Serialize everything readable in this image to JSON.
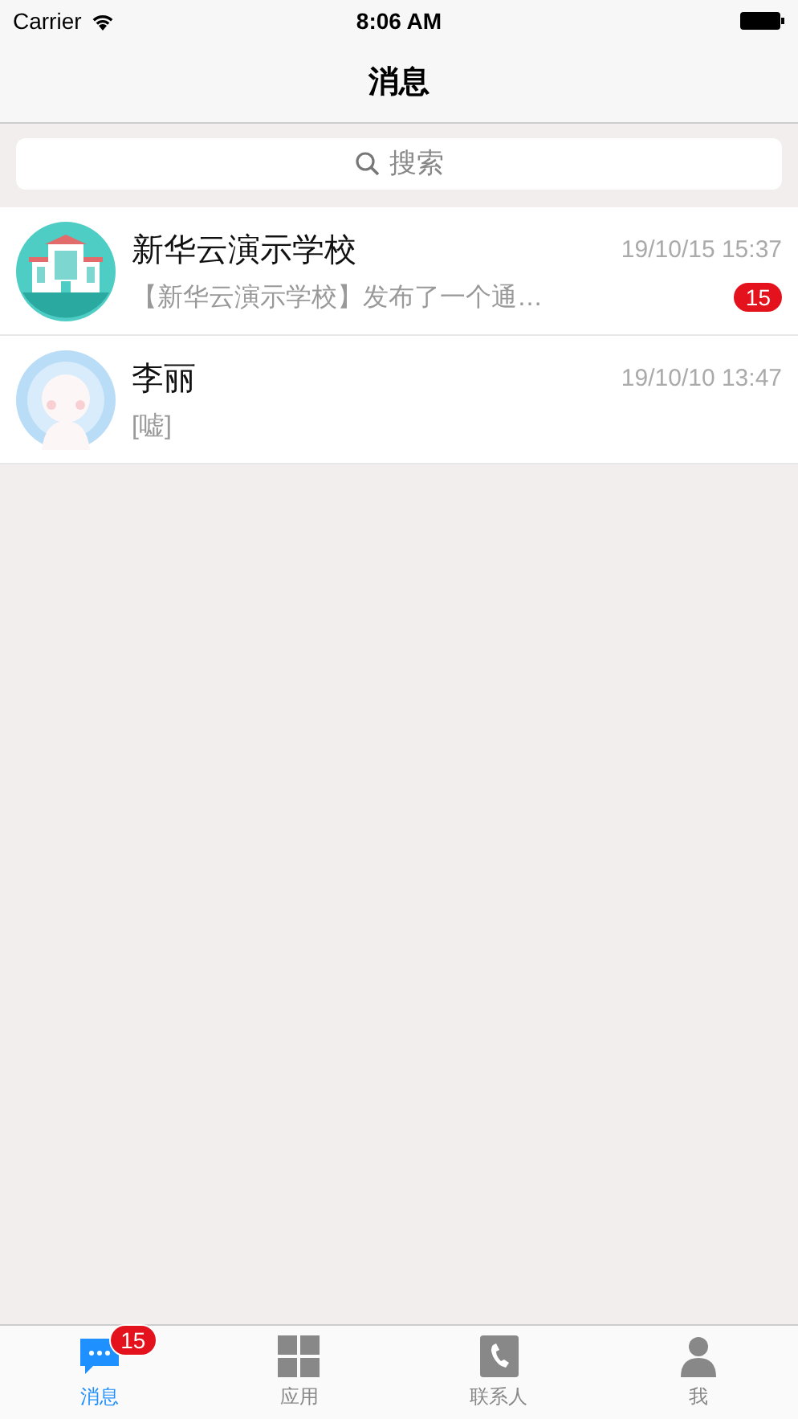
{
  "status_bar": {
    "carrier": "Carrier",
    "time": "8:06 AM"
  },
  "nav": {
    "title": "消息"
  },
  "search": {
    "placeholder": "搜索"
  },
  "conversations": [
    {
      "kind": "school",
      "name": "新华云演示学校",
      "time": "19/10/15 15:37",
      "preview": "【新华云演示学校】发布了一个通…",
      "unread": "15"
    },
    {
      "kind": "person",
      "name": "李丽",
      "time": "19/10/10 13:47",
      "preview": "[嘘]"
    }
  ],
  "tabs": [
    {
      "kind": "chat",
      "label": "消息",
      "selected": true,
      "badge": "15"
    },
    {
      "kind": "grid",
      "label": "应用",
      "selected": false
    },
    {
      "kind": "phone",
      "label": "联系人",
      "selected": false
    },
    {
      "kind": "person",
      "label": "我",
      "selected": false
    }
  ]
}
